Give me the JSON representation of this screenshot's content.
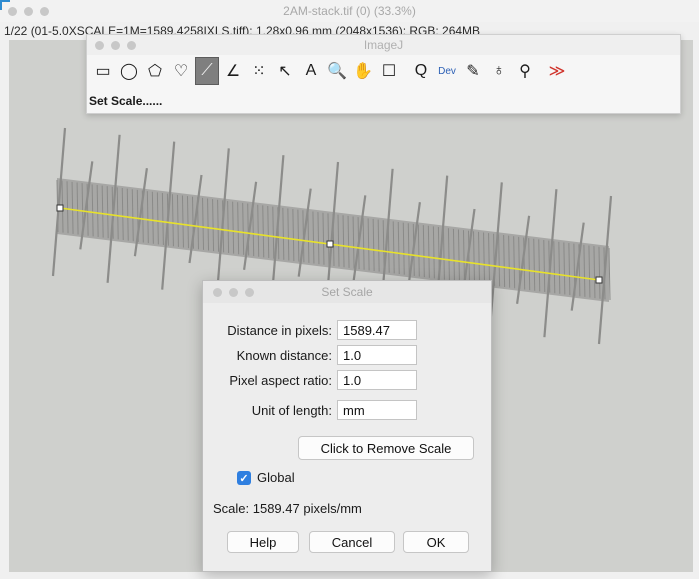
{
  "back_window": {
    "title": "2AM-stack.tif (0) (33.3%)",
    "info": "1/22 (01-5.0XSCALE=1M=1589.4258IXLS.tiff): 1.28x0.96 mm (2048x1536); RGB; 264MB"
  },
  "toolbar": {
    "title": "ImageJ",
    "status": "Set Scale......",
    "tools": [
      {
        "name": "rectangle-tool",
        "glyph": "▭",
        "selected": false
      },
      {
        "name": "oval-tool",
        "glyph": "◯",
        "selected": false
      },
      {
        "name": "polygon-tool",
        "glyph": "⬠",
        "selected": false
      },
      {
        "name": "freehand-tool",
        "glyph": "♡",
        "selected": false
      },
      {
        "name": "line-tool",
        "glyph": "⟋",
        "selected": true
      },
      {
        "name": "angle-tool",
        "glyph": "∠",
        "selected": false
      },
      {
        "name": "point-tool",
        "glyph": "⁙",
        "selected": false
      },
      {
        "name": "wand-tool",
        "glyph": "↖",
        "selected": false
      },
      {
        "name": "text-tool",
        "glyph": "A",
        "selected": false
      },
      {
        "name": "magnifier-tool",
        "glyph": "🔍",
        "selected": false
      },
      {
        "name": "scroll-tool",
        "glyph": "✋",
        "selected": false
      },
      {
        "name": "color-picker-tool",
        "glyph": "☐",
        "selected": false
      },
      {
        "name": "zoom-tool",
        "glyph": "Q",
        "selected": false
      },
      {
        "name": "developer-menu",
        "glyph": "Dev",
        "selected": false
      },
      {
        "name": "pencil-tool",
        "glyph": "✎",
        "selected": false
      },
      {
        "name": "paintbrush-tool",
        "glyph": "♁",
        "selected": false
      },
      {
        "name": "dropper-tool",
        "glyph": "⚲",
        "selected": false
      },
      {
        "name": "more-tools",
        "glyph": "≫",
        "selected": false
      }
    ]
  },
  "dialog": {
    "title": "Set Scale",
    "fields": [
      {
        "label": "Distance in pixels:",
        "value": "1589.47"
      },
      {
        "label": "Known distance:",
        "value": "1.0"
      },
      {
        "label": "Pixel aspect ratio:",
        "value": "1.0"
      },
      {
        "label": "Unit of length:",
        "value": "mm"
      }
    ],
    "remove_scale_label": "Click to Remove Scale",
    "global_label": "Global",
    "global_checked": true,
    "scale_text": "Scale: 1589.47 pixels/mm",
    "buttons": {
      "help": "Help",
      "cancel": "Cancel",
      "ok": "OK"
    }
  },
  "colors": {
    "selection_line": "#e8e22a",
    "checkbox_accent": "#2f7fe0",
    "more_tools_accent": "#d0342c"
  }
}
